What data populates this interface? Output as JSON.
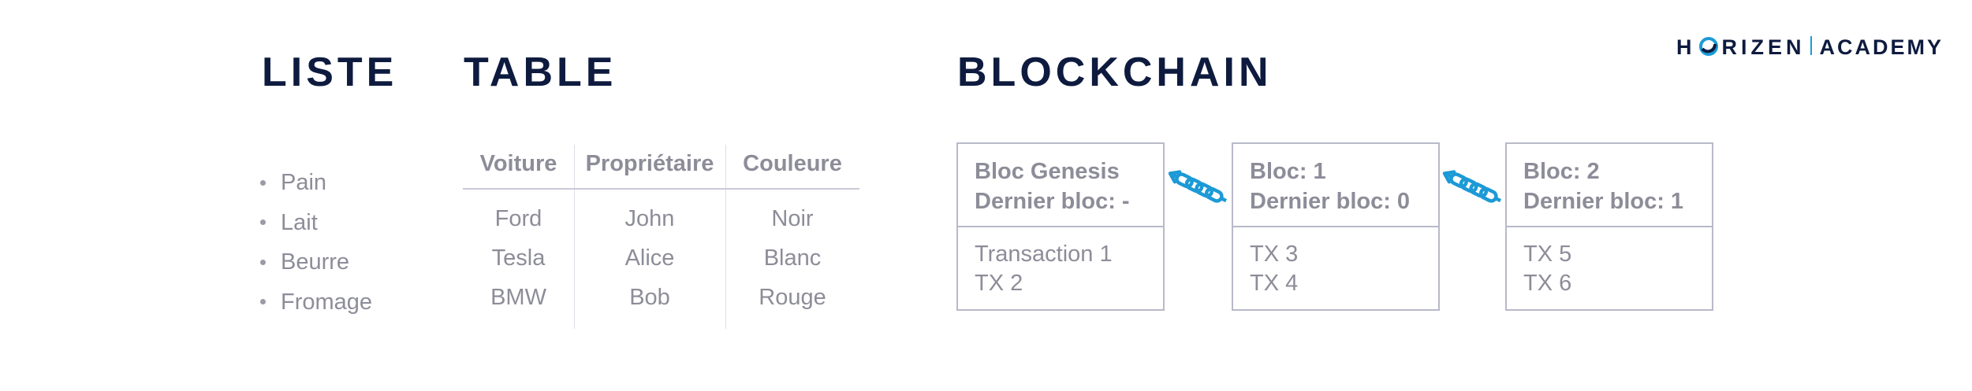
{
  "logo": {
    "brand_pre": "H",
    "brand_post": "RIZEN",
    "brand_suffix": "ACADEMY",
    "colors": {
      "navy": "#0e1b3f",
      "blue": "#1c9ad6"
    }
  },
  "headings": {
    "list": "LISTE",
    "table": "TABLE",
    "blockchain": "BLOCKCHAIN"
  },
  "list": {
    "items": [
      "Pain",
      "Lait",
      "Beurre",
      "Fromage"
    ]
  },
  "table": {
    "columns": [
      "Voiture",
      "Propriétaire",
      "Couleure"
    ],
    "rows": [
      [
        "Ford",
        "John",
        "Noir"
      ],
      [
        "Tesla",
        "Alice",
        "Blanc"
      ],
      [
        "BMW",
        "Bob",
        "Rouge"
      ]
    ]
  },
  "blockchain": {
    "blocks": [
      {
        "title": "Bloc Genesis",
        "previous": "Dernier bloc: -",
        "transactions": [
          "Transaction 1",
          "TX 2"
        ]
      },
      {
        "title": "Bloc: 1",
        "previous": "Dernier bloc: 0",
        "transactions": [
          "TX 3",
          "TX 4"
        ]
      },
      {
        "title": "Bloc: 2",
        "previous": "Dernier bloc: 1",
        "transactions": [
          "TX 5",
          "TX 6"
        ]
      }
    ],
    "links": [
      {
        "from": "Bloc: 1",
        "to": "Bloc Genesis",
        "icon": "chain-link-icon"
      },
      {
        "from": "Bloc: 2",
        "to": "Bloc: 1",
        "icon": "chain-link-icon"
      }
    ],
    "colors": {
      "text": "#8d8d99",
      "border": "#b8b9c9",
      "chain": "#1c9ad6"
    }
  }
}
